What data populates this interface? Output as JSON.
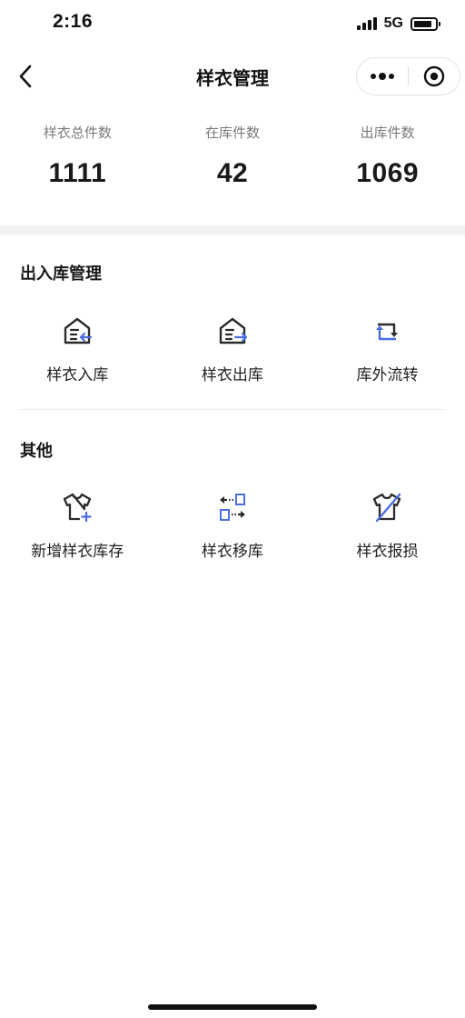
{
  "status_bar": {
    "time": "2:16",
    "network": "5G",
    "battery_level": 0.85,
    "signal_bars": 4
  },
  "nav": {
    "title": "样衣管理",
    "back_icon": "chevron-left-icon",
    "more_icon": "more-dots-icon",
    "close_icon": "target-circle-icon"
  },
  "stats": [
    {
      "label": "样衣总件数",
      "value": "1111"
    },
    {
      "label": "在库件数",
      "value": "42"
    },
    {
      "label": "出库件数",
      "value": "1069"
    }
  ],
  "sections": [
    {
      "title": "出入库管理",
      "items": [
        {
          "label": "样衣入库",
          "icon": "warehouse-in-icon"
        },
        {
          "label": "样衣出库",
          "icon": "warehouse-out-icon"
        },
        {
          "label": "库外流转",
          "icon": "transfer-loop-icon"
        }
      ]
    },
    {
      "title": "其他",
      "items": [
        {
          "label": "新增样衣库存",
          "icon": "shirt-add-icon"
        },
        {
          "label": "样衣移库",
          "icon": "move-stock-icon"
        },
        {
          "label": "样衣报损",
          "icon": "shirt-damaged-icon"
        }
      ]
    }
  ],
  "colors": {
    "accent": "#4a6ee0",
    "icon_dark": "#2b2b2b",
    "label_gray": "#7a7a7a",
    "band_gray": "#f2f2f2"
  }
}
